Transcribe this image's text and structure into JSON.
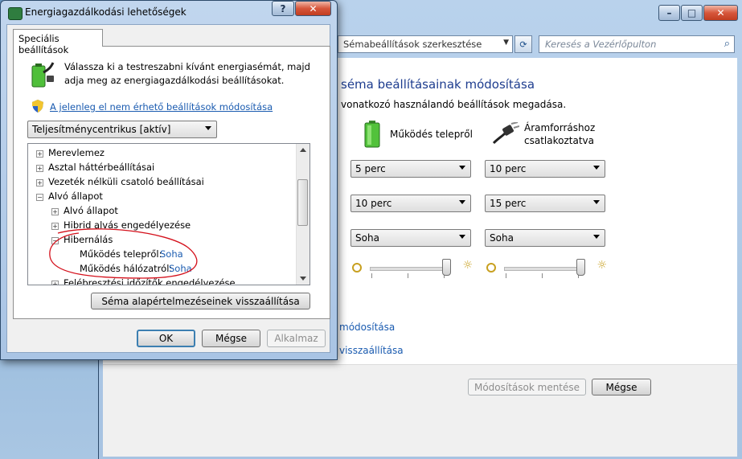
{
  "background_window": {
    "address": "Sémabeállítások szerkesztése",
    "search_placeholder": "Keresés a Vezérlőpulton",
    "heading": "séma beállításainak módosítása",
    "subheading": "vonatkozó használandó beállítások megadása.",
    "columns": {
      "battery": "Működés telepről",
      "plugged_line1": "Áramforráshoz",
      "plugged_line2": "csatlakoztatva"
    },
    "rows": [
      {
        "battery": "5 perc",
        "plugged": "10 perc"
      },
      {
        "battery": "10 perc",
        "plugged": "15 perc"
      },
      {
        "battery": "Soha",
        "plugged": "Soha"
      }
    ],
    "brightness": {
      "battery": 0.9,
      "plugged": 0.9
    },
    "link1": "módosítása",
    "link2": "visszaállítása",
    "save_button": "Módosítások mentése",
    "cancel_button": "Mégse",
    "caption_min": "–",
    "caption_max": "□",
    "caption_close": "✕"
  },
  "dialog": {
    "title": "Energiagazdálkodási lehetőségek",
    "help": "?",
    "close": "✕",
    "tab": "Speciális beállítások",
    "intro": "Válassza ki a testreszabni kívánt energiasémát, majd adja meg az energiagazdálkodási beállításokat.",
    "change_link": "A jelenleg el nem érhető beállítások módosítása",
    "scheme_select": "Teljesítménycentrikus [aktív]",
    "tree": [
      {
        "label": "Merevlemez",
        "level": 0,
        "expander": "+"
      },
      {
        "label": "Asztal háttérbeállításai",
        "level": 0,
        "expander": "+"
      },
      {
        "label": "Vezeték nélküli csatoló beállításai",
        "level": 0,
        "expander": "+"
      },
      {
        "label": "Alvó állapot",
        "level": 0,
        "expander": "−"
      },
      {
        "label": "Alvó állapot",
        "level": 1,
        "expander": "+"
      },
      {
        "label": "Hibrid alvás engedélyezése",
        "level": 1,
        "expander": "+"
      },
      {
        "label": "Hibernálás",
        "level": 1,
        "expander": "−"
      },
      {
        "label": "Működés telepről:",
        "level": 2,
        "value": "Soha"
      },
      {
        "label": "Működés hálózatról:",
        "level": 2,
        "value": "Soha"
      },
      {
        "label": "Felébresztési időzítők engedélyezése",
        "level": 1,
        "expander": "+"
      }
    ],
    "restore_button": "Séma alapértelmezéseinek visszaállítása",
    "ok_button": "OK",
    "cancel_button": "Mégse",
    "apply_button": "Alkalmaz"
  },
  "colors": {
    "link": "#1a5bb0",
    "heading": "#1e3d8f",
    "annotation": "#d4101b"
  }
}
